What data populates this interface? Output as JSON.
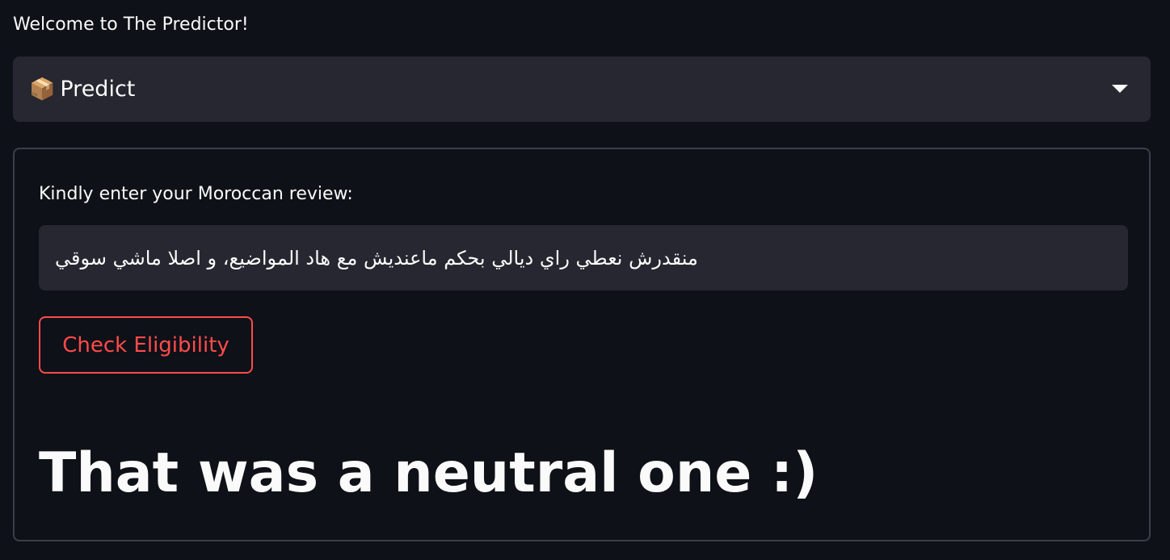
{
  "header": {
    "welcome_text": "Welcome to The Predictor!"
  },
  "mode_select": {
    "icon": "📦",
    "icon_name": "package-icon",
    "selected_label": "Predict"
  },
  "form": {
    "input_label": "Kindly enter your Moroccan review:",
    "review_value": "منقدرش نعطي راي ديالي بحكم ماعنديش مع هاد المواضيع، و اصلا ماشي سوقي",
    "submit_label": "Check Eligibility",
    "result_text": "That was a neutral one :)"
  },
  "colors": {
    "background": "#0e1117",
    "surface": "#262730",
    "accent": "#ff4b4b",
    "border": "#3d3f48",
    "text": "#fafafa"
  }
}
